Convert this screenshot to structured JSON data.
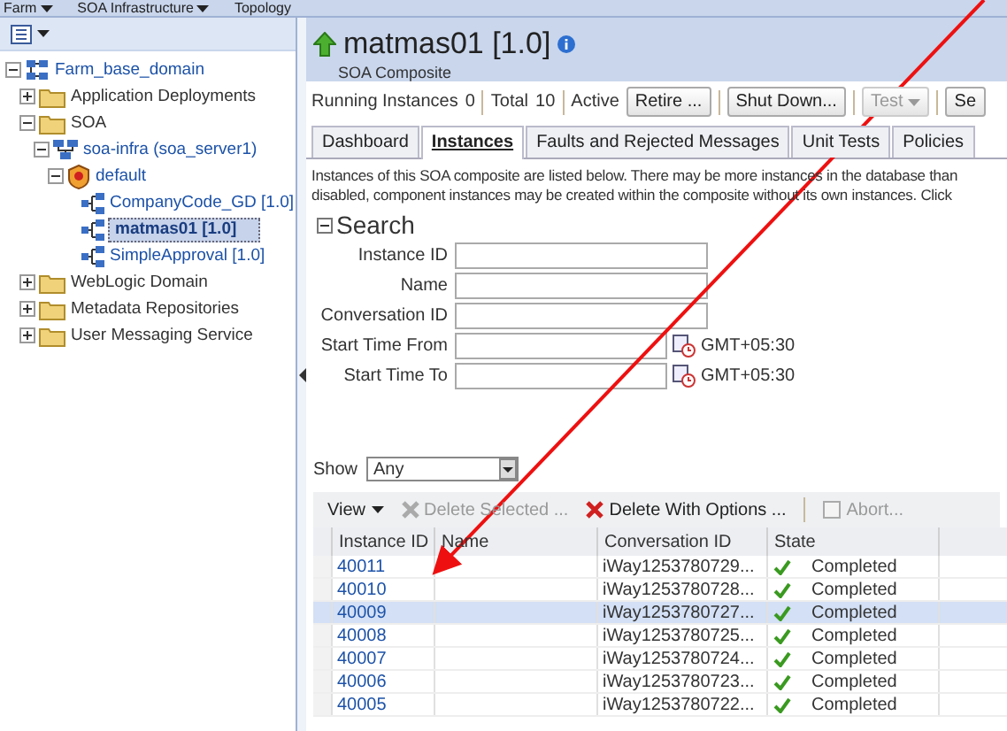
{
  "top_menu": [
    {
      "label": "Farm",
      "has_caret": true
    },
    {
      "label": "SOA Infrastructure",
      "has_caret": true
    },
    {
      "label": "Topology",
      "has_caret": false
    }
  ],
  "tree": [
    {
      "label": "Farm_base_domain",
      "kind": "domain",
      "expanded": true,
      "selected": false,
      "children": [
        {
          "label": "Application Deployments",
          "kind": "folder",
          "expanded": false,
          "selected": false
        },
        {
          "label": "SOA",
          "kind": "folder",
          "expanded": true,
          "selected": false,
          "children": [
            {
              "label": "soa-infra (soa_server1)",
              "kind": "server",
              "expanded": true,
              "selected": false,
              "children": [
                {
                  "label": "default",
                  "kind": "partition",
                  "expanded": true,
                  "selected": false,
                  "children": [
                    {
                      "label": "CompanyCode_GD [1.0]",
                      "kind": "composite",
                      "selected": false
                    },
                    {
                      "label": "matmas01 [1.0]",
                      "kind": "composite",
                      "selected": true
                    },
                    {
                      "label": "SimpleApproval [1.0]",
                      "kind": "composite",
                      "selected": false
                    }
                  ]
                }
              ]
            }
          ]
        },
        {
          "label": "WebLogic Domain",
          "kind": "folder",
          "expanded": false,
          "selected": false
        },
        {
          "label": "Metadata Repositories",
          "kind": "folder",
          "expanded": false,
          "selected": false
        },
        {
          "label": "User Messaging Service",
          "kind": "folder",
          "expanded": false,
          "selected": false
        }
      ]
    }
  ],
  "header": {
    "title": "matmas01 [1.0]",
    "subtitle": "SOA Composite"
  },
  "status": {
    "running_label": "Running Instances",
    "running_value": "0",
    "total_label": "Total",
    "total_value": "10",
    "mode": "Active"
  },
  "actions": [
    {
      "label": "Retire ...",
      "disabled": false,
      "has_caret": false
    },
    {
      "label": "Shut Down...",
      "disabled": false,
      "has_caret": false
    },
    {
      "label": "Test",
      "disabled": true,
      "has_caret": true
    },
    {
      "label": "Se",
      "disabled": false,
      "has_caret": false
    }
  ],
  "tabs": [
    {
      "label": "Dashboard",
      "selected": false
    },
    {
      "label": "Instances",
      "selected": true
    },
    {
      "label": "Faults and Rejected Messages",
      "selected": false
    },
    {
      "label": "Unit Tests",
      "selected": false
    },
    {
      "label": "Policies",
      "selected": false
    }
  ],
  "description": [
    "Instances of this SOA composite are listed below. There may be more instances in the database than",
    "disabled, component instances may be created within the composite without its own instances. Click"
  ],
  "search": {
    "title": "Search",
    "expanded": true,
    "fields": [
      {
        "label": "Instance ID",
        "kind": "text"
      },
      {
        "label": "Name",
        "kind": "text"
      },
      {
        "label": "Conversation ID",
        "kind": "text"
      },
      {
        "label": "Start Time From",
        "kind": "datetime",
        "timezone": "GMT+05:30"
      },
      {
        "label": "Start Time To",
        "kind": "datetime",
        "timezone": "GMT+05:30"
      }
    ]
  },
  "show": {
    "label": "Show",
    "value": "Any"
  },
  "table_toolbar": [
    {
      "label": "View",
      "kind": "menu",
      "disabled": false
    },
    {
      "label": "Delete Selected ...",
      "kind": "delete",
      "disabled": true
    },
    {
      "label": "Delete With Options ...",
      "kind": "delete",
      "disabled": false
    },
    {
      "label": "Abort...",
      "kind": "abort",
      "disabled": true
    }
  ],
  "table": {
    "columns": [
      "Instance ID",
      "Name",
      "Conversation ID",
      "State"
    ],
    "rows": [
      {
        "instance_id": "40011",
        "conversation_id": "iWay1253780729...",
        "state": "Completed",
        "selected": false
      },
      {
        "instance_id": "40010",
        "conversation_id": "iWay1253780728...",
        "state": "Completed",
        "selected": false
      },
      {
        "instance_id": "40009",
        "conversation_id": "iWay1253780727...",
        "state": "Completed",
        "selected": true
      },
      {
        "instance_id": "40008",
        "conversation_id": "iWay1253780725...",
        "state": "Completed",
        "selected": false
      },
      {
        "instance_id": "40007",
        "conversation_id": "iWay1253780724...",
        "state": "Completed",
        "selected": false
      },
      {
        "instance_id": "40006",
        "conversation_id": "iWay1253780723...",
        "state": "Completed",
        "selected": false
      },
      {
        "instance_id": "40005",
        "conversation_id": "iWay1253780722...",
        "state": "Completed",
        "selected": false
      }
    ]
  }
}
